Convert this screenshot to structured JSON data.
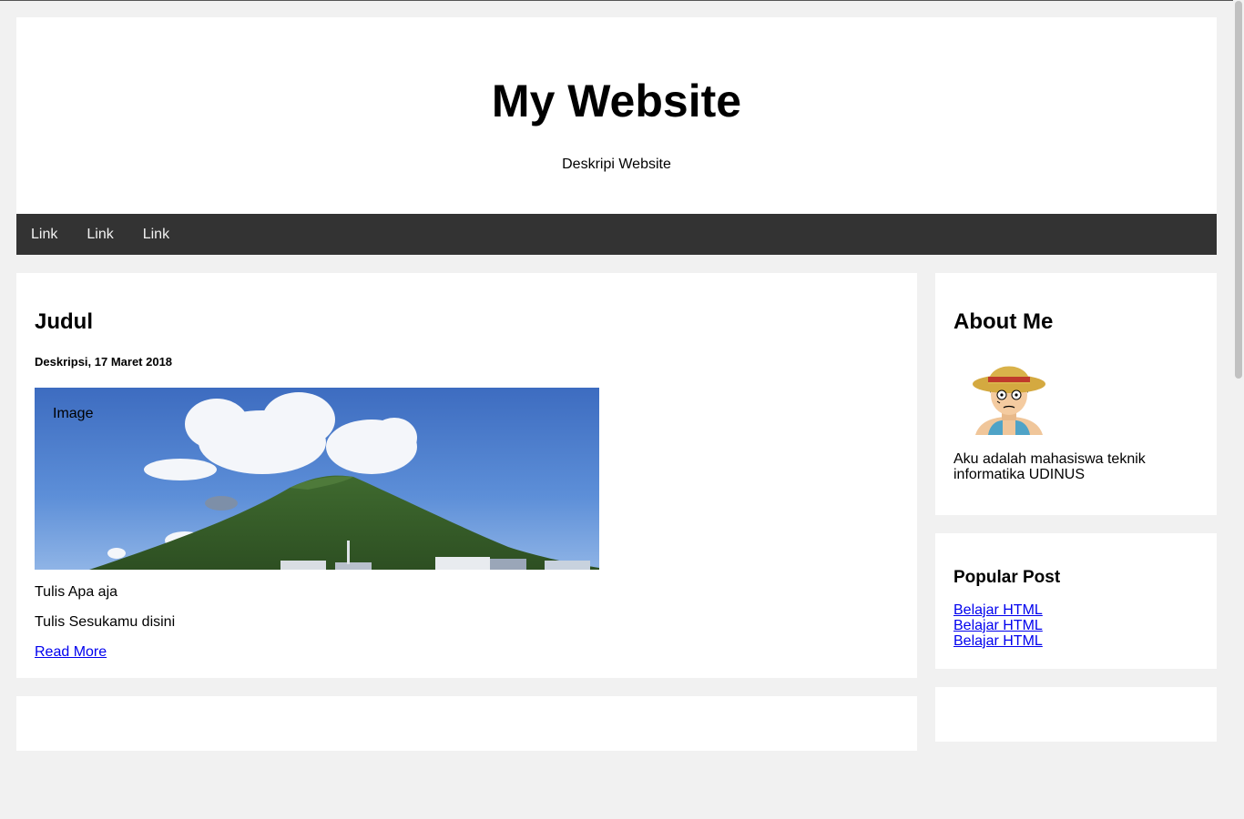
{
  "header": {
    "title": "My Website",
    "description": "Deskripi Website"
  },
  "nav": {
    "links": [
      "Link",
      "Link",
      "Link"
    ]
  },
  "post": {
    "title": "Judul",
    "meta": "Deskripsi, 17 Maret 2018",
    "image_label": "Image",
    "paragraph1": "Tulis Apa aja",
    "paragraph2": "Tulis Sesukamu disini",
    "read_more": "Read More"
  },
  "about": {
    "title": "About Me",
    "text": "Aku adalah mahasiswa teknik informatika UDINUS"
  },
  "popular": {
    "title": "Popular Post",
    "items": [
      "Belajar HTML",
      "Belajar HTML",
      "Belajar HTML"
    ]
  },
  "colors": {
    "nav_bg": "#333333",
    "page_bg": "#f1f1f1",
    "link": "#0000ee"
  }
}
